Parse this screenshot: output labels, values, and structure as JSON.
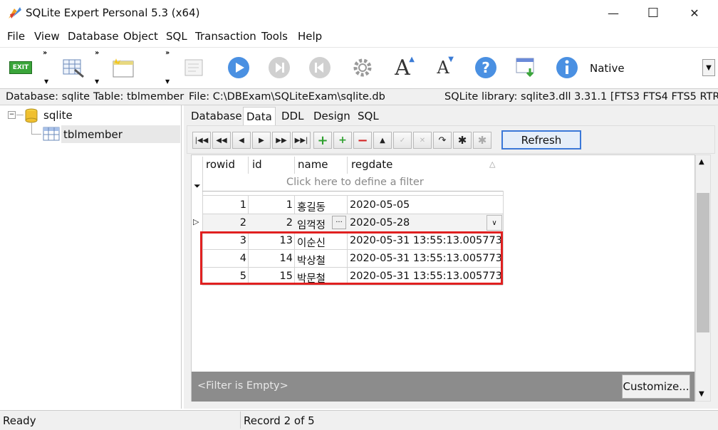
{
  "window": {
    "title": "SQLite Expert Personal 5.3 (x64)",
    "minimize": "—",
    "maximize": "☐",
    "close": "✕"
  },
  "menu": [
    "File",
    "View",
    "Database",
    "Object",
    "SQL",
    "Transaction",
    "Tools",
    "Help"
  ],
  "toolbar": {
    "exit_label": "EXIT",
    "font_letter": "A",
    "native_label": "Native"
  },
  "infobar": {
    "database": "Database: sqlite",
    "table": "Table: tblmember",
    "file": "File: C:\\DBExam\\SQLiteExam\\sqlite.db",
    "library": "SQLite library: sqlite3.dll 3.31.1 [FTS3 FTS4 FTS5 RTREE]"
  },
  "tree": {
    "database": "sqlite",
    "table": "tblmember"
  },
  "tabs": [
    "Database",
    "Data",
    "DDL",
    "Design",
    "SQL"
  ],
  "refresh_label": "Refresh",
  "grid": {
    "columns": [
      "rowid",
      "id",
      "name",
      "regdate"
    ],
    "filter_hint": "Click here to define a filter",
    "rows": [
      {
        "rowid": "1",
        "id": "1",
        "name": "홍길동",
        "regdate": "2020-05-05"
      },
      {
        "rowid": "2",
        "id": "2",
        "name": "임꺽정",
        "regdate": "2020-05-28"
      },
      {
        "rowid": "3",
        "id": "13",
        "name": "이순신",
        "regdate": "2020-05-31 13:55:13.005773"
      },
      {
        "rowid": "4",
        "id": "14",
        "name": "박상철",
        "regdate": "2020-05-31 13:55:13.005773"
      },
      {
        "rowid": "5",
        "id": "15",
        "name": "박문철",
        "regdate": "2020-05-31 13:55:13.005773"
      }
    ],
    "ellipsis": "···",
    "filter_footer": "<Filter is Empty>",
    "customize_label": "Customize..."
  },
  "status": {
    "left": "Ready",
    "record": "Record 2 of 5"
  },
  "colors": {
    "highlight_box": "#e02020",
    "refresh_border": "#3b78d8"
  }
}
